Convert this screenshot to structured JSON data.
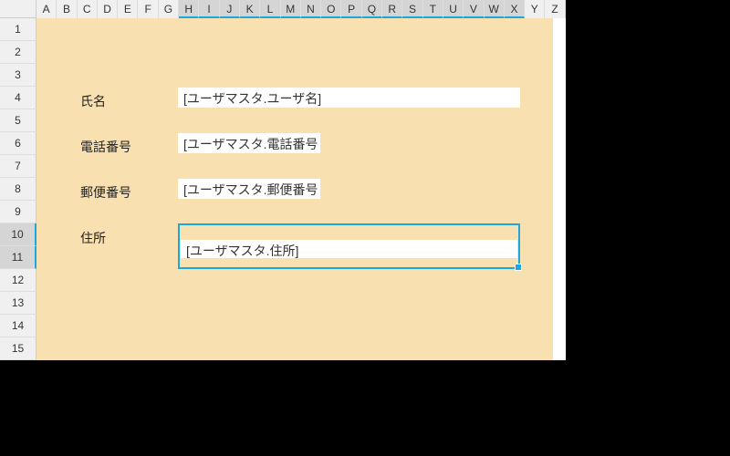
{
  "columns": [
    "A",
    "B",
    "C",
    "D",
    "E",
    "F",
    "G",
    "H",
    "I",
    "J",
    "K",
    "L",
    "M",
    "N",
    "O",
    "P",
    "Q",
    "R",
    "S",
    "T",
    "U",
    "V",
    "W",
    "X",
    "Y",
    "Z"
  ],
  "selectedCols": [
    "H",
    "I",
    "J",
    "K",
    "L",
    "M",
    "N",
    "O",
    "P",
    "Q",
    "R",
    "S",
    "T",
    "U",
    "V",
    "W",
    "X"
  ],
  "rows": [
    "1",
    "2",
    "3",
    "4",
    "5",
    "6",
    "7",
    "8",
    "9",
    "10",
    "11",
    "12",
    "13",
    "14",
    "15"
  ],
  "selectedRows": [
    "10",
    "11"
  ],
  "labels": {
    "name": "氏名",
    "phone": "電話番号",
    "postal": "郵便番号",
    "address": "住所"
  },
  "fields": {
    "name": "[ユーザマスタ.ユーザ名]",
    "phone": "[ユーザマスタ.電話番号",
    "postal": "[ユーザマスタ.郵便番号",
    "address": "[ユーザマスタ.住所]"
  }
}
